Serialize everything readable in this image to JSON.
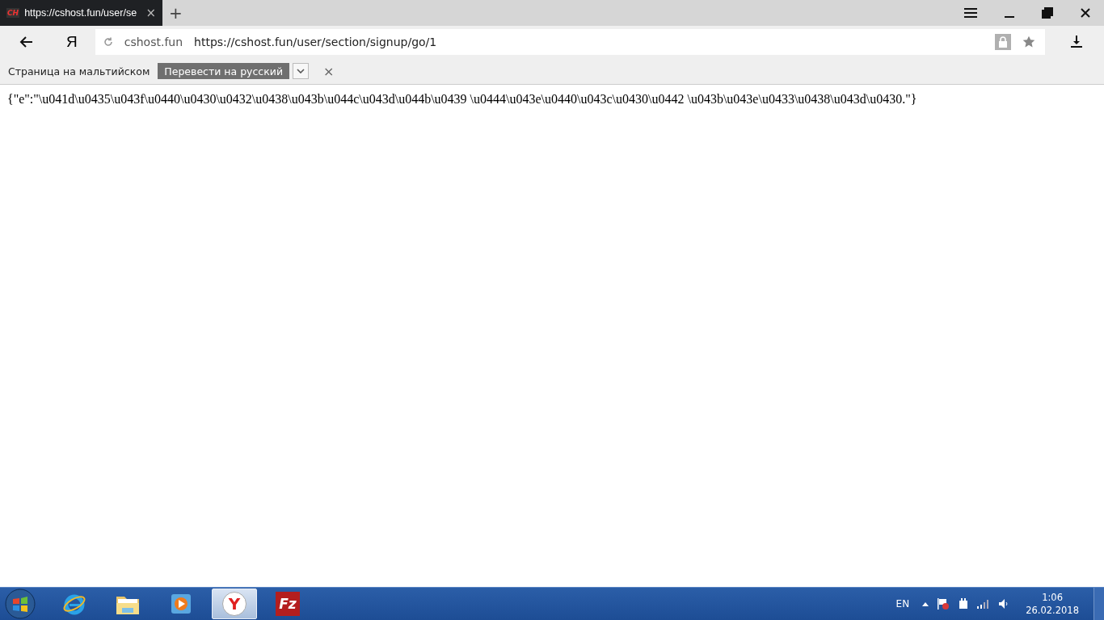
{
  "tab": {
    "favicon": "CH",
    "title": "https://cshost.fun/user/se",
    "close": "×"
  },
  "new_tab": "+",
  "toolbar": {
    "yandex_button": "Я",
    "site": "cshost.fun",
    "url": "https://cshost.fun/user/section/signup/go/1"
  },
  "translate_bar": {
    "message": "Страница на мальтийском",
    "button": "Перевести на русский",
    "close": "×"
  },
  "page_text": "{\"e\":\"\\u041d\\u0435\\u043f\\u0440\\u0430\\u0432\\u0438\\u043b\\u044c\\u043d\\u044b\\u0439 \\u0444\\u043e\\u0440\\u043c\\u0430\\u0442 \\u043b\\u043e\\u0433\\u0438\\u043d\\u0430.\"}",
  "taskbar": {
    "items": [
      {
        "kind": "ie",
        "selected": false
      },
      {
        "kind": "folder",
        "selected": false
      },
      {
        "kind": "media",
        "selected": false
      },
      {
        "kind": "yandex",
        "label": "Y",
        "selected": true
      },
      {
        "kind": "filezilla",
        "label": "Fz",
        "selected": false
      }
    ],
    "language": "EN",
    "time": "1:06",
    "date": "26.02.2018"
  }
}
